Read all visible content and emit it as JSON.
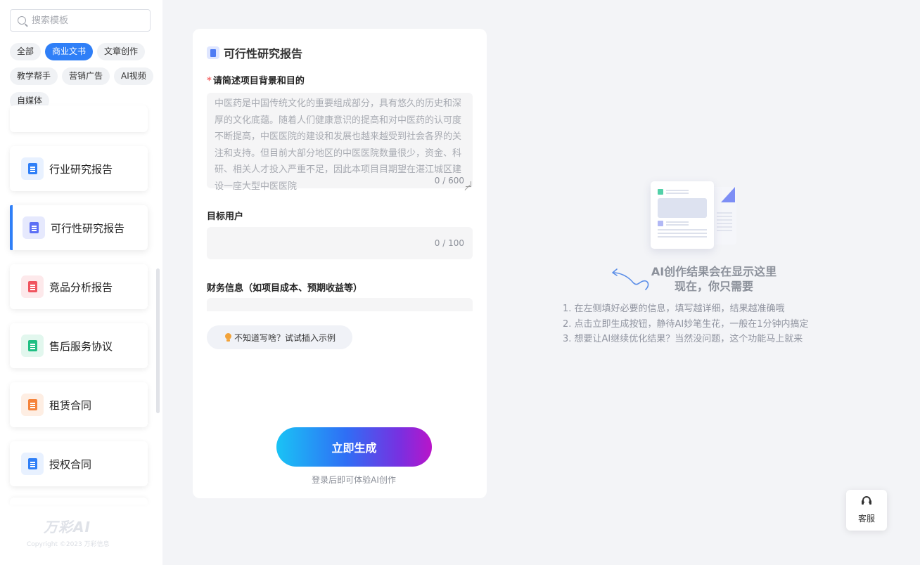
{
  "sidebar": {
    "search_placeholder": "搜索模板",
    "tags": [
      {
        "label": "全部",
        "active": false
      },
      {
        "label": "商业文书",
        "active": true
      },
      {
        "label": "文章创作",
        "active": false
      },
      {
        "label": "教学帮手",
        "active": false
      },
      {
        "label": "营销广告",
        "active": false
      },
      {
        "label": "AI视频",
        "active": false
      },
      {
        "label": "自媒体",
        "active": false
      }
    ],
    "templates": [
      {
        "label": "行业研究报告",
        "icon": "report-icon",
        "color": "#2f7ff7",
        "bg": "#e8f1ff",
        "active": false
      },
      {
        "label": "可行性研究报告",
        "icon": "clipboard-icon",
        "color": "#5b6ef5",
        "bg": "#e6e9fd",
        "active": true
      },
      {
        "label": "竞品分析报告",
        "icon": "vs-report-icon",
        "color": "#f0545f",
        "bg": "#fde9eb",
        "active": false
      },
      {
        "label": "售后服务协议",
        "icon": "agreement-icon",
        "color": "#1fbf83",
        "bg": "#e2f7ee",
        "active": false
      },
      {
        "label": "租赁合同",
        "icon": "contract-star-icon",
        "color": "#f5833a",
        "bg": "#feeee3",
        "active": false
      },
      {
        "label": "授权合同",
        "icon": "license-icon",
        "color": "#2f7ff7",
        "bg": "#e8f1ff",
        "active": false
      }
    ],
    "brand": "万彩AI",
    "copyright": "Copyright ©2023 万彩信息"
  },
  "form": {
    "title": "可行性研究报告",
    "field1": {
      "label": "请简述项目背景和目的",
      "required_mark": "*",
      "placeholder": "中医药是中国传统文化的重要组成部分，具有悠久的历史和深厚的文化底蕴。随着人们健康意识的提高和对中医药的认可度不断提高，中医医院的建设和发展也越来越受到社会各界的关注和支持。但目前大部分地区的中医医院数量很少，资金、科研、相关人才投入严重不足，因此本项目目期望在湛江城区建设一座大型中医医院",
      "counter": "0 / 600"
    },
    "field2": {
      "label": "目标用户",
      "counter": "0 / 100"
    },
    "field3": {
      "label": "财务信息（如项目成本、预期收益等）"
    },
    "hint": "不知道写啥？试试插入示例",
    "generate_label": "立即生成",
    "login_tip": "登录后即可体验AI创作"
  },
  "result": {
    "title_line1": "AI创作结果会在显示这里",
    "title_line2": "现在，你只需要",
    "steps": [
      "1. 在左侧填好必要的信息，填写越详细，结果越准确哦",
      "2. 点击立即生成按钮，静待AI妙笔生花，一般在1分钟内搞定",
      "3. 想要让AI继续优化结果？当然没问题，这个功能马上就来"
    ]
  },
  "service": {
    "label": "客服",
    "icon": "headset-icon"
  }
}
